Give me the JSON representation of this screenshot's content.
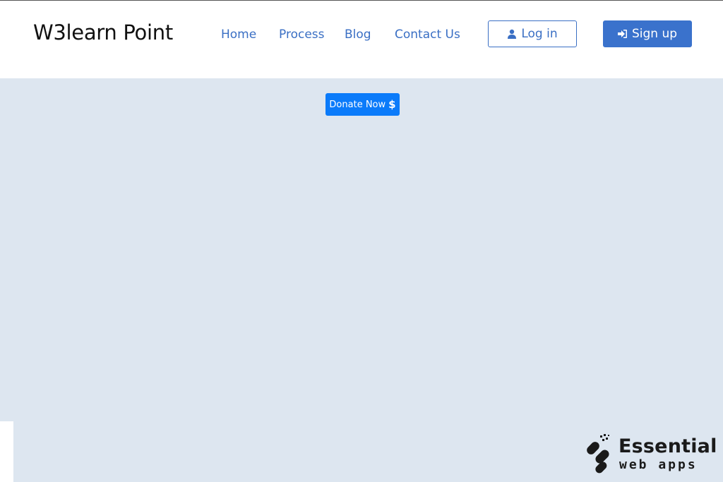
{
  "header": {
    "brand": "W3learn Point",
    "nav": [
      {
        "label": "Home"
      },
      {
        "label": "Process"
      },
      {
        "label": "Blog"
      },
      {
        "label": "Contact Us"
      }
    ],
    "login_label": "Log in",
    "signup_label": "Sign up"
  },
  "main": {
    "donate_label": "Donate Now",
    "donate_symbol": "$"
  },
  "watermark": {
    "title": "Essential",
    "subtitle": "web apps"
  },
  "colors": {
    "link": "#3a6fc4",
    "primary": "#3a72cc",
    "donate": "#0b7bfa",
    "background": "#dde6f0"
  },
  "icons": {
    "login": "user-icon",
    "signup": "sign-in-icon"
  }
}
